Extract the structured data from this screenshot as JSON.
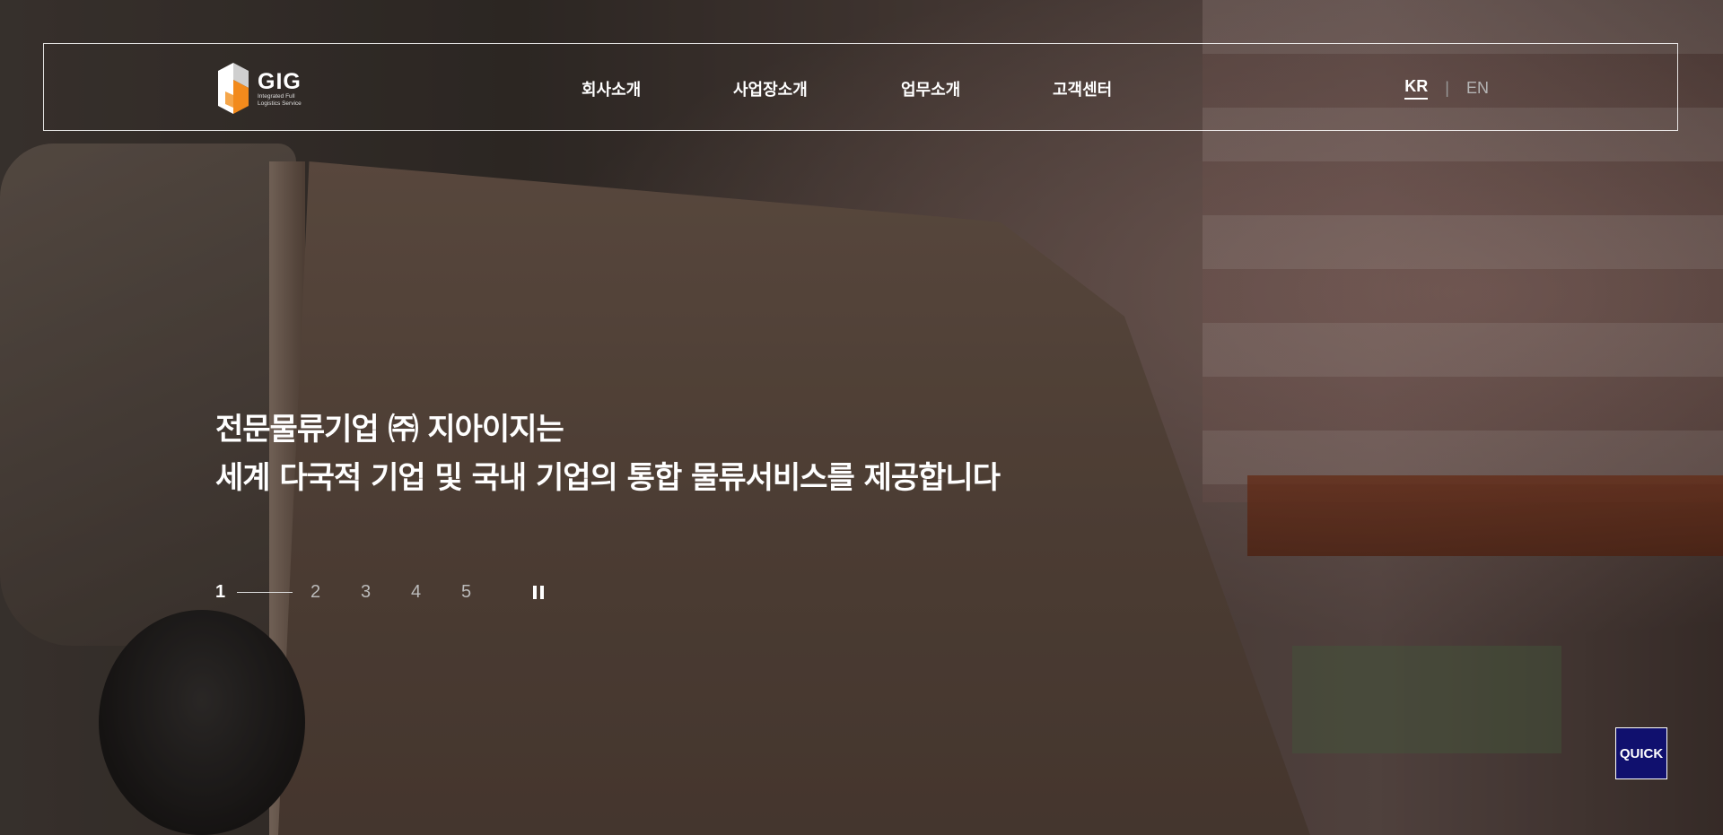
{
  "header": {
    "logo": {
      "name": "GIG",
      "tagline_line1": "Integrated Full",
      "tagline_line2": "Logistics Service",
      "icon": "gig-cube-logo-icon"
    },
    "nav": [
      {
        "label": "회사소개"
      },
      {
        "label": "사업장소개"
      },
      {
        "label": "업무소개"
      },
      {
        "label": "고객센터"
      }
    ],
    "language": {
      "active": "KR",
      "separator": "|",
      "other": "EN"
    }
  },
  "hero": {
    "headline_line1": "전문물류기업 ㈜ 지아이지는",
    "headline_line2": "세계 다국적 기업 및 국내 기업의 통합 물류서비스를 제공합니다"
  },
  "slider": {
    "current": "1",
    "pages": [
      "2",
      "3",
      "4",
      "5"
    ],
    "pause_icon": "pause-icon"
  },
  "quick_button": {
    "label": "QUICK",
    "color": "#10106e"
  }
}
